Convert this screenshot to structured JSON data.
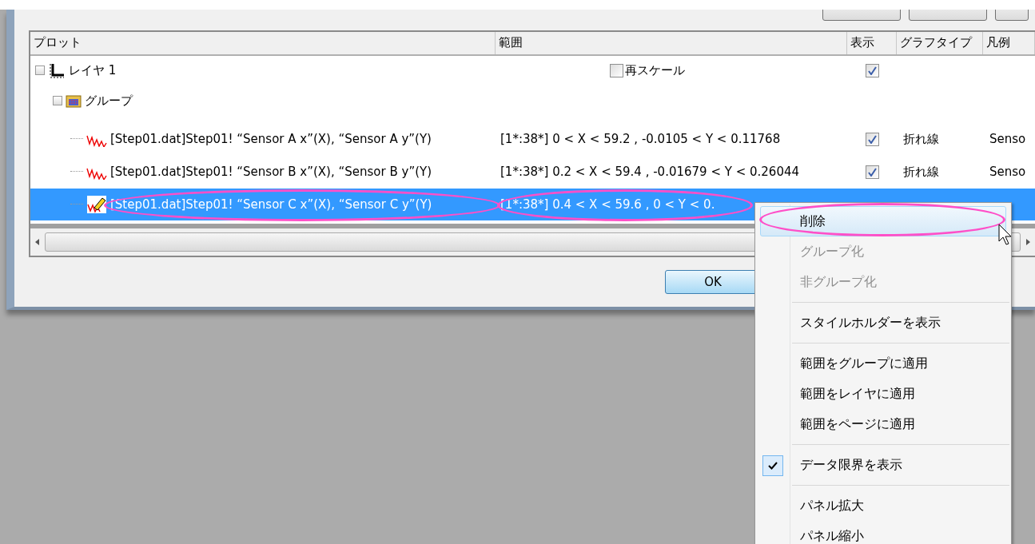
{
  "plot_table": {
    "columns": [
      "プロット",
      "範囲",
      "表示",
      "グラフタイプ",
      "凡例"
    ],
    "tree": [
      {
        "kind": "layer",
        "label": "レイヤ 1",
        "expanded": true,
        "rescale": {
          "label": "再スケール",
          "checked": false
        },
        "show": true,
        "children": [
          {
            "kind": "group",
            "label": "グループ",
            "expanded": true,
            "children": [
              {
                "kind": "plot",
                "name": "[Step01.dat]Step01! “Sensor A x”(X), “Sensor A y”(Y)",
                "range": "[1*:38*]  0 < X < 59.2 , -0.0105 < Y < 0.11768",
                "show": true,
                "graph_type": "折れ線",
                "legend": "Senso",
                "selected": false
              },
              {
                "kind": "plot",
                "name": "[Step01.dat]Step01! “Sensor B x”(X), “Sensor B y”(Y)",
                "range": "[1*:38*]  0.2 < X < 59.4 , -0.01679 < Y < 0.26044",
                "show": true,
                "graph_type": "折れ線",
                "legend": "Senso",
                "selected": false
              },
              {
                "kind": "plot",
                "name": "[Step01.dat]Step01! “Sensor C x”(X), “Sensor C y”(Y)",
                "range": "[1*:38*]  0.4 < X < 59.6 , 0 < Y < 0.",
                "selected": true
              }
            ]
          }
        ]
      }
    ]
  },
  "buttons": [
    "OK"
  ],
  "context_menu": [
    {
      "kind": "item",
      "label": "削除",
      "selected": true,
      "disabled": false,
      "checked": false
    },
    {
      "kind": "item",
      "label": "グループ化",
      "selected": false,
      "disabled": true,
      "checked": false
    },
    {
      "kind": "item",
      "label": "非グループ化",
      "selected": false,
      "disabled": true,
      "checked": false
    },
    {
      "kind": "separator"
    },
    {
      "kind": "item",
      "label": "スタイルホルダーを表示",
      "selected": false,
      "disabled": false,
      "checked": false
    },
    {
      "kind": "separator"
    },
    {
      "kind": "item",
      "label": "範囲をグループに適用",
      "selected": false,
      "disabled": false,
      "checked": false
    },
    {
      "kind": "item",
      "label": "範囲をレイヤに適用",
      "selected": false,
      "disabled": false,
      "checked": false
    },
    {
      "kind": "item",
      "label": "範囲をページに適用",
      "selected": false,
      "disabled": false,
      "checked": false
    },
    {
      "kind": "separator"
    },
    {
      "kind": "item",
      "label": "データ限界を表示",
      "selected": false,
      "disabled": false,
      "checked": true
    },
    {
      "kind": "separator"
    },
    {
      "kind": "item",
      "label": "パネル拡大",
      "selected": false,
      "disabled": false,
      "checked": false
    },
    {
      "kind": "item",
      "label": "パネル縮小",
      "selected": false,
      "disabled": false,
      "checked": false
    }
  ]
}
